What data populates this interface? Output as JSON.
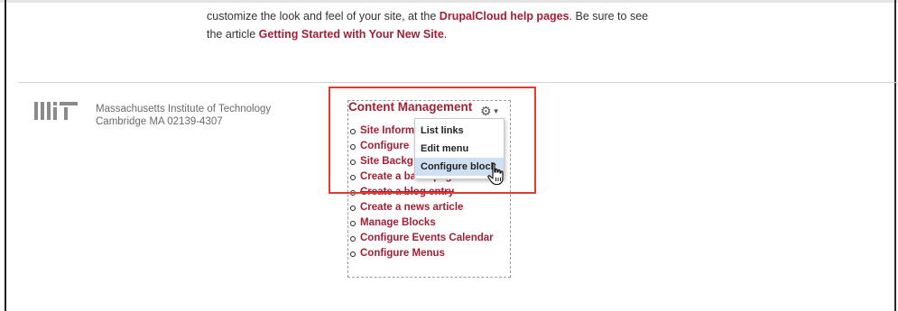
{
  "intro": {
    "line1_prefix": "customize the look and feel of your site, at the ",
    "link1": "DrupalCloud help pages",
    "line1_suffix": ". Be sure to see",
    "line2_prefix": "the article ",
    "link2": "Getting Started with Your New Site",
    "line2_suffix": "."
  },
  "footer": {
    "logo_icon": "mit-logo",
    "address_line1": "Massachusetts Institute of Technology",
    "address_line2": "Cambridge MA 02139-4307"
  },
  "block": {
    "title": "Content Management",
    "gear_icon": "gear-icon",
    "links": [
      "Site Inform",
      "Configure",
      "Site Backg",
      "Create a basic page",
      "Create a blog entry",
      "Create a news article",
      "Manage Blocks",
      "Configure Events Calendar",
      "Configure Menus"
    ]
  },
  "context_menu": {
    "items": [
      "List links",
      "Edit menu",
      "Configure block"
    ],
    "highlighted": "Configure block"
  },
  "colors": {
    "link": "#a31f34",
    "annotation": "#e03c31",
    "menu_highlight": "#cfe0f2"
  }
}
